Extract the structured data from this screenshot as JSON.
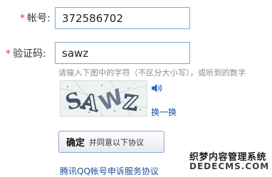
{
  "account": {
    "required_mark": "*",
    "label": "帐号:",
    "value": "372586702"
  },
  "captcha_input": {
    "required_mark": "*",
    "label": "验证码:",
    "value": "sawz",
    "hint": "请输入下图中的字符（不区分大小写），或听到的数字"
  },
  "captcha": {
    "image_text": "SAWZ",
    "audio_icon": "speaker-icon",
    "refresh_label": "换一换"
  },
  "confirm": {
    "main_label": "确定",
    "sub_label": "并同意以下协议"
  },
  "agreement_link": "腾讯QQ帐号申诉服务协议",
  "watermark": {
    "line1": "织梦内容管理系统",
    "line2": "DEDECMS.COM"
  },
  "colors": {
    "required": "#e4393c",
    "link": "#1a4f9c",
    "input_border": "#7fa8c9"
  }
}
